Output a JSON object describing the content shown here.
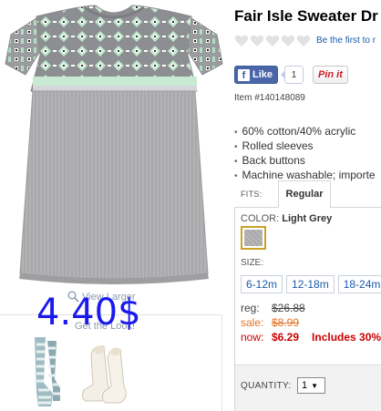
{
  "product": {
    "title": "Fair Isle Sweater Dr",
    "review_link": "Be the first to r",
    "item_number": "Item #140148089",
    "features": [
      "60% cotton/40% acrylic",
      "Rolled sleeves",
      "Back buttons",
      "Machine washable; importe"
    ]
  },
  "social": {
    "like_label": "Like",
    "like_count": "1",
    "pin_label": "Pin it"
  },
  "image_panel": {
    "view_larger": "View Larger",
    "get_look": "Get the Look!",
    "price_overlay": "4.40$"
  },
  "fits": {
    "label": "FITS:",
    "selected_tab": "Regular"
  },
  "color": {
    "label": "COLOR:",
    "value": "Light Grey",
    "swatch_color": "#b0b0b0"
  },
  "size": {
    "label": "SIZE:",
    "options": [
      "6-12m",
      "12-18m",
      "18-24m"
    ]
  },
  "pricing": {
    "reg_label": "reg:",
    "reg_value": "$26.88",
    "sale_label": "sale:",
    "sale_value": "$8.99",
    "now_label": "now:",
    "now_value": "$6.29",
    "now_note": "Includes 30%"
  },
  "quantity": {
    "label": "QUANTITY:",
    "value": "1"
  },
  "colors": {
    "link_blue": "#1a5ca8",
    "sale_orange": "#e37222",
    "now_red": "#cc0000",
    "facebook_blue": "#4a66a8",
    "pinterest_red": "#cb2027",
    "overlay_blue": "#1a1aee"
  }
}
